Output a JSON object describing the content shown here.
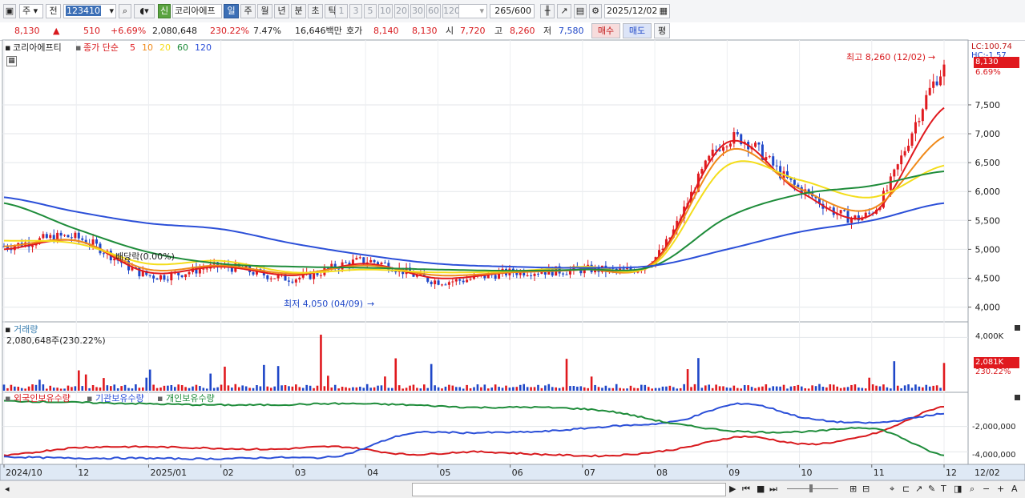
{
  "toolbar": {
    "market_label": "주",
    "prev_label": "전",
    "code_value": "123410",
    "name_value": "코리아에프",
    "new_badge": "신",
    "periods": [
      "일",
      "주",
      "월",
      "년",
      "분",
      "초",
      "틱"
    ],
    "minutes": [
      "1",
      "3",
      "5",
      "10",
      "20",
      "30",
      "60",
      "120"
    ],
    "bars_shown": "265",
    "bars_total": "/600",
    "date_value": "2025/12/02"
  },
  "quote": {
    "price": "8,130",
    "arrow": "▲",
    "change": "510",
    "change_pct": "+6.69%",
    "volume": "2,080,648",
    "volume_ratio": "230.22%",
    "turnover_pct": "7.47%",
    "amount": "16,646백만",
    "quote_label": "호가",
    "ask": "8,140",
    "bid": "8,130",
    "open_label": "시",
    "open": "7,720",
    "high_label": "고",
    "high": "8,260",
    "low_label": "저",
    "low": "7,580",
    "buy_button": "매수",
    "sell_button": "매도",
    "eval_button": "평"
  },
  "price_panel": {
    "name": "코리아에프티",
    "legend_title": "종가 단순",
    "ma_labels": [
      "5",
      "10",
      "20",
      "60",
      "120"
    ],
    "ma_colors": [
      "#e0191e",
      "#f08a1a",
      "#f4dd1b",
      "#1e8c3a",
      "#2b4fd8"
    ],
    "lc_label": "LC:100.74",
    "hc_label": "HC:-1.57",
    "price_tag": "8,130",
    "pct_tag": "6.69%",
    "high_note": "최고 8,260 (12/02)",
    "low_note": "최저 4,050 (04/09)",
    "dividend_note": "배당락(0.00%)"
  },
  "volume_panel": {
    "title": "거래량",
    "readout": "2,080,648주(230.22%)",
    "axis_label": "4,000K",
    "value_tag": "2,081K",
    "pct_tag": "230.22%"
  },
  "holdings_panel": {
    "legend": [
      "외국인보유수량",
      "기관보유수량",
      "개인보유수량"
    ],
    "axis_labels": [
      "-2,000,000",
      "-4,000,000"
    ]
  },
  "x_axis": {
    "labels": [
      "2024/10",
      "12",
      "2025/01",
      "02",
      "03",
      "04",
      "05",
      "06",
      "07",
      "08",
      "09",
      "10",
      "11",
      "12",
      "12/02"
    ]
  },
  "chart_data": {
    "type": "line",
    "title": "코리아에프티",
    "subtitle": "종가 단순 5 10 20 60 120",
    "x_labels": [
      "2024/10",
      "12",
      "2025/01",
      "02",
      "03",
      "04",
      "05",
      "06",
      "07",
      "08",
      "09",
      "10",
      "11",
      "12"
    ],
    "y_ticks": [
      4000,
      4500,
      5000,
      5500,
      6000,
      6500,
      7000,
      7500
    ],
    "ylim": [
      3800,
      8400
    ],
    "close_monthly": [
      5050,
      5200,
      4550,
      4700,
      4500,
      4800,
      4450,
      4600,
      4650,
      4850,
      6900,
      6050,
      5650,
      8130
    ],
    "series": [
      {
        "name": "5",
        "values": [
          5000,
          5150,
          4600,
          4700,
          4550,
          4750,
          4500,
          4600,
          4650,
          4800,
          6850,
          6000,
          5600,
          7450
        ]
      },
      {
        "name": "10",
        "values": [
          5050,
          5150,
          4650,
          4720,
          4580,
          4720,
          4550,
          4600,
          4650,
          4780,
          6700,
          6050,
          5700,
          6950
        ]
      },
      {
        "name": "20",
        "values": [
          5150,
          5100,
          4750,
          4800,
          4600,
          4650,
          4600,
          4620,
          4700,
          4750,
          6450,
          6200,
          5900,
          6450
        ]
      },
      {
        "name": "60",
        "values": [
          5800,
          5350,
          4950,
          4750,
          4700,
          4680,
          4650,
          4630,
          4650,
          4720,
          5550,
          5950,
          6100,
          6350
        ]
      },
      {
        "name": "120",
        "values": [
          5900,
          5650,
          5450,
          5350,
          5100,
          4900,
          4750,
          4700,
          4680,
          4720,
          5000,
          5300,
          5500,
          5800
        ]
      }
    ],
    "annotations": [
      "최고 8,260 (12/02)",
      "최저 4,050 (04/09)",
      "배당락(0.00%)"
    ],
    "volume": {
      "ylim": [
        0,
        4800
      ],
      "peak_k": 4200,
      "last_k": 2081
    },
    "holdings": {
      "ylim": [
        -4800000,
        500000
      ],
      "series": [
        {
          "name": "외국인보유수량",
          "values": [
            -4300000,
            -3700000,
            -3600000,
            -3700000,
            -3800000,
            -3600000,
            -4200000,
            -4000000,
            -4200000,
            -4300000,
            -3800000,
            -2800000,
            -3400000,
            -2500000,
            -400000
          ]
        },
        {
          "name": "기관보유수량",
          "values": [
            -4400000,
            -4500000,
            -4500000,
            -4550000,
            -4450000,
            -4300000,
            -2600000,
            -2500000,
            -2400000,
            -2000000,
            -1600000,
            -200000,
            -1400000,
            -1700000,
            -1000000
          ]
        },
        {
          "name": "개인보유수량",
          "values": [
            0,
            -100000,
            -200000,
            -300000,
            -300000,
            -200000,
            -300000,
            -500000,
            -500000,
            -800000,
            -1800000,
            -2400000,
            -2400000,
            -2200000,
            -4300000
          ]
        }
      ]
    }
  }
}
